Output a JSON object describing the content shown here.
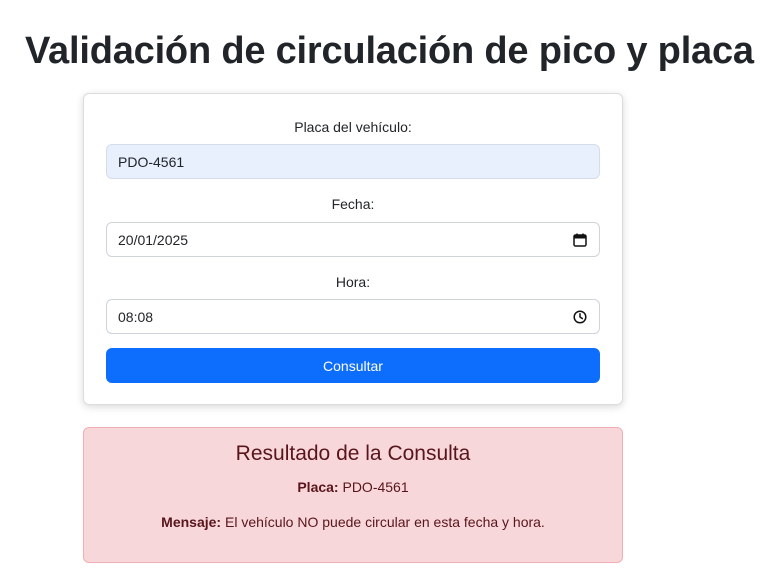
{
  "page": {
    "title": "Validación de circulación de pico y placa"
  },
  "form": {
    "plate_label": "Placa del vehículo:",
    "plate_value": "PDO-4561",
    "date_label": "Fecha:",
    "date_value": "20/01/2025",
    "time_label": "Hora:",
    "time_value": "08:08",
    "submit_label": "Consultar"
  },
  "result": {
    "title": "Resultado de la Consulta",
    "plate_key": "Placa:",
    "plate_value": "PDO-4561",
    "message_key": "Mensaje:",
    "message_value": "El vehículo NO puede circular en esta fecha y hora."
  },
  "icons": {
    "date": "calendar-icon",
    "time": "clock-icon"
  },
  "colors": {
    "primary": "#0d6efd",
    "danger_bg": "#f8d7da",
    "danger_text": "#58151c",
    "autofill_bg": "#e8f0fe"
  }
}
